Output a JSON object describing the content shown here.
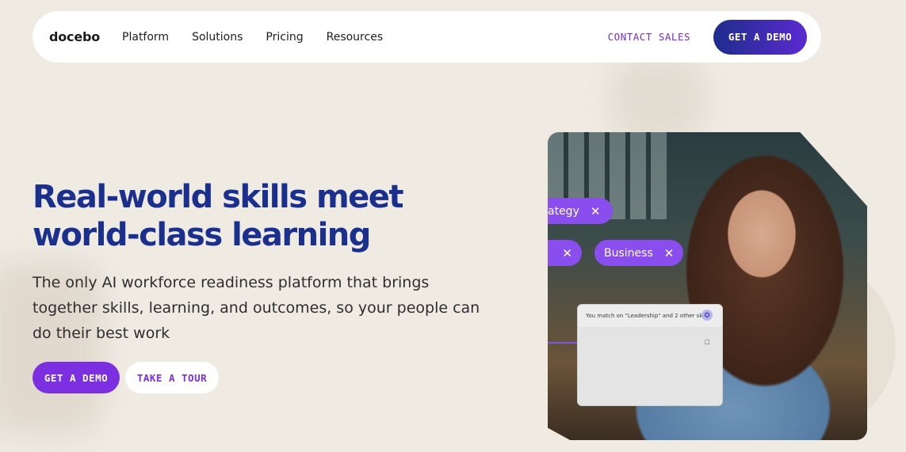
{
  "nav": {
    "logo": "docebo",
    "links": [
      "Platform",
      "Solutions",
      "Pricing",
      "Resources"
    ],
    "contact_sales": "CONTACT SALES",
    "get_demo": "GET A DEMO"
  },
  "hero": {
    "headline_line1": "Real-world skills meet",
    "headline_line2": "world-class learning",
    "subtitle": "The only AI workforce readiness platform that brings together skills, learning, and outcomes, so your people can do their best work",
    "primary_button": "GET A DEMO",
    "secondary_button": "TAKE A TOUR"
  },
  "visual": {
    "chip_strategy": "ategy",
    "chip_business": "Business",
    "chip_close": "✕",
    "match_text": "You match on \"Leadership\" and 2 other skills",
    "match_icon": "❂",
    "bookmark_icon": "🔖"
  },
  "colors": {
    "background": "#efebe3",
    "headline": "#1b2f8c",
    "accent": "#7b2fe0"
  }
}
